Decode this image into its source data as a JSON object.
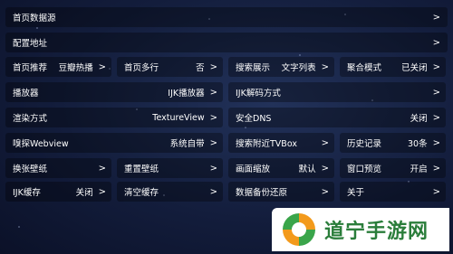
{
  "rows_full": [
    {
      "label": "首页数据源",
      "arrow": ">"
    },
    {
      "label": "配置地址",
      "arrow": ">"
    }
  ],
  "grid": [
    [
      {
        "label": "首页推荐",
        "value": "豆瓣热播",
        "arrow": ">"
      },
      {
        "label": "首页多行",
        "value": "否",
        "arrow": ">"
      },
      {
        "label": "搜索展示",
        "value": "文字列表",
        "arrow": ">"
      },
      {
        "label": "聚合模式",
        "value": "已关闭",
        "arrow": ">"
      }
    ],
    [
      {
        "label": "播放器",
        "value": "IJK播放器",
        "arrow": ">"
      },
      {
        "label": "IJK解码方式",
        "value": "",
        "arrow": ">"
      }
    ],
    [
      {
        "label": "渲染方式",
        "value": "TextureView",
        "arrow": ">"
      },
      {
        "label": "安全DNS",
        "value": "关闭",
        "arrow": ">"
      }
    ],
    [
      {
        "label": "嗅探Webview",
        "value": "系统自带",
        "arrow": ">"
      },
      {
        "label": "搜索附近TVBox",
        "value": "",
        "arrow": ">"
      },
      {
        "label": "历史记录",
        "value": "30条",
        "arrow": ">"
      }
    ],
    [
      {
        "label": "换张壁纸",
        "value": "",
        "arrow": ">"
      },
      {
        "label": "重置壁纸",
        "value": "",
        "arrow": ">"
      },
      {
        "label": "画面缩放",
        "value": "默认",
        "arrow": ">"
      },
      {
        "label": "窗口预览",
        "value": "开启",
        "arrow": ">"
      }
    ],
    [
      {
        "label": "IJK缓存",
        "value": "关闭",
        "arrow": ">"
      },
      {
        "label": "清空缓存",
        "value": "",
        "arrow": ">"
      },
      {
        "label": "数据备份还原",
        "value": "",
        "arrow": ">"
      },
      {
        "label": "关于",
        "value": "",
        "arrow": ">"
      }
    ]
  ],
  "watermark": {
    "text": "道宁手游网"
  },
  "colors": {
    "accent": "#2a7d3a",
    "logo_orange": "#f39a1c",
    "logo_green": "#3aa54a"
  }
}
